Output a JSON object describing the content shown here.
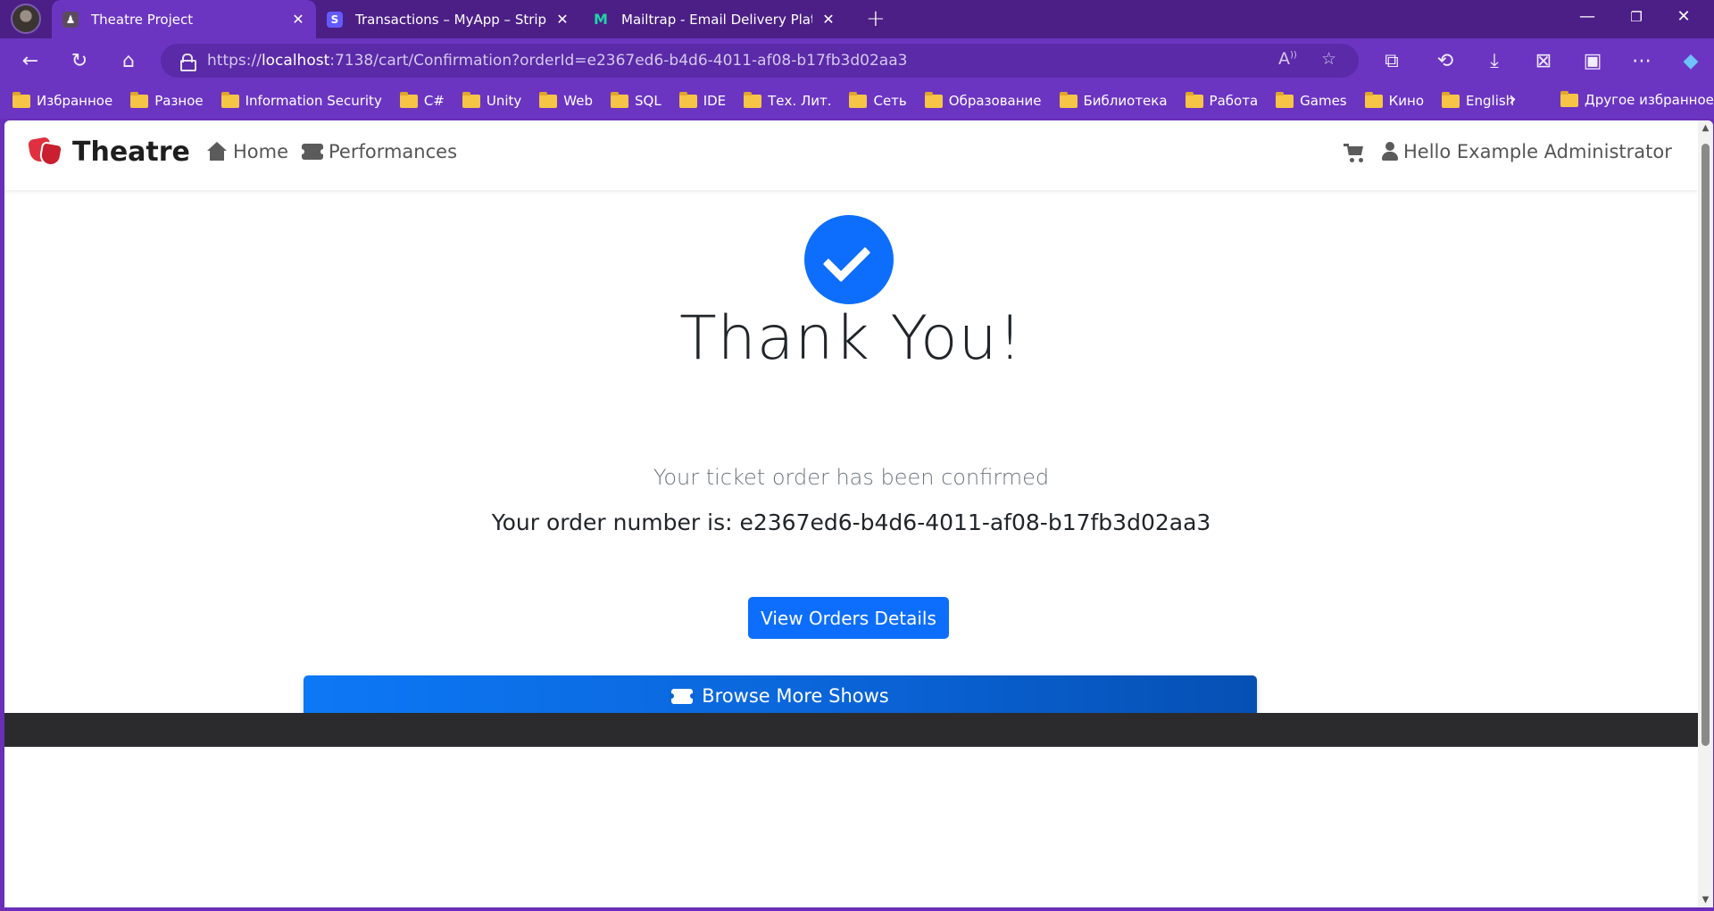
{
  "browser": {
    "tabs": [
      {
        "title": "Theatre Project",
        "active": true
      },
      {
        "title": "Transactions – MyApp – Stripe [Te",
        "active": false
      },
      {
        "title": "Mailtrap - Email Delivery Platform",
        "active": false
      }
    ],
    "url": {
      "scheme": "https://",
      "host": "localhost",
      "rest": ":7138/cart/Confirmation?orderId=e2367ed6-b4d6-4011-af08-b17fb3d02aa3"
    },
    "bookmarks": [
      "Избранное",
      "Разное",
      "Information Security",
      "C#",
      "Unity",
      "Web",
      "SQL",
      "IDE",
      "Тех. Лит.",
      "Сеть",
      "Образование",
      "Библиотека",
      "Работа",
      "Games",
      "Кино",
      "English"
    ],
    "other_bookmarks": "Другое избранное",
    "colors": {
      "chrome_dark": "#4b1f86",
      "chrome": "#6b35c2",
      "accent": "#0d6efd"
    }
  },
  "navbar": {
    "brand": "Theatre",
    "home": "Home",
    "performances": "Performances",
    "user_greeting": "Hello Example Administrator"
  },
  "confirmation": {
    "title": "Thank You!",
    "subtitle": "Your ticket order has been confirmed",
    "order_line": "Your order number is: e2367ed6-b4d6-4011-af08-b17fb3d02aa3",
    "details_button": "View Orders Details",
    "browse_button": "Browse More Shows"
  }
}
